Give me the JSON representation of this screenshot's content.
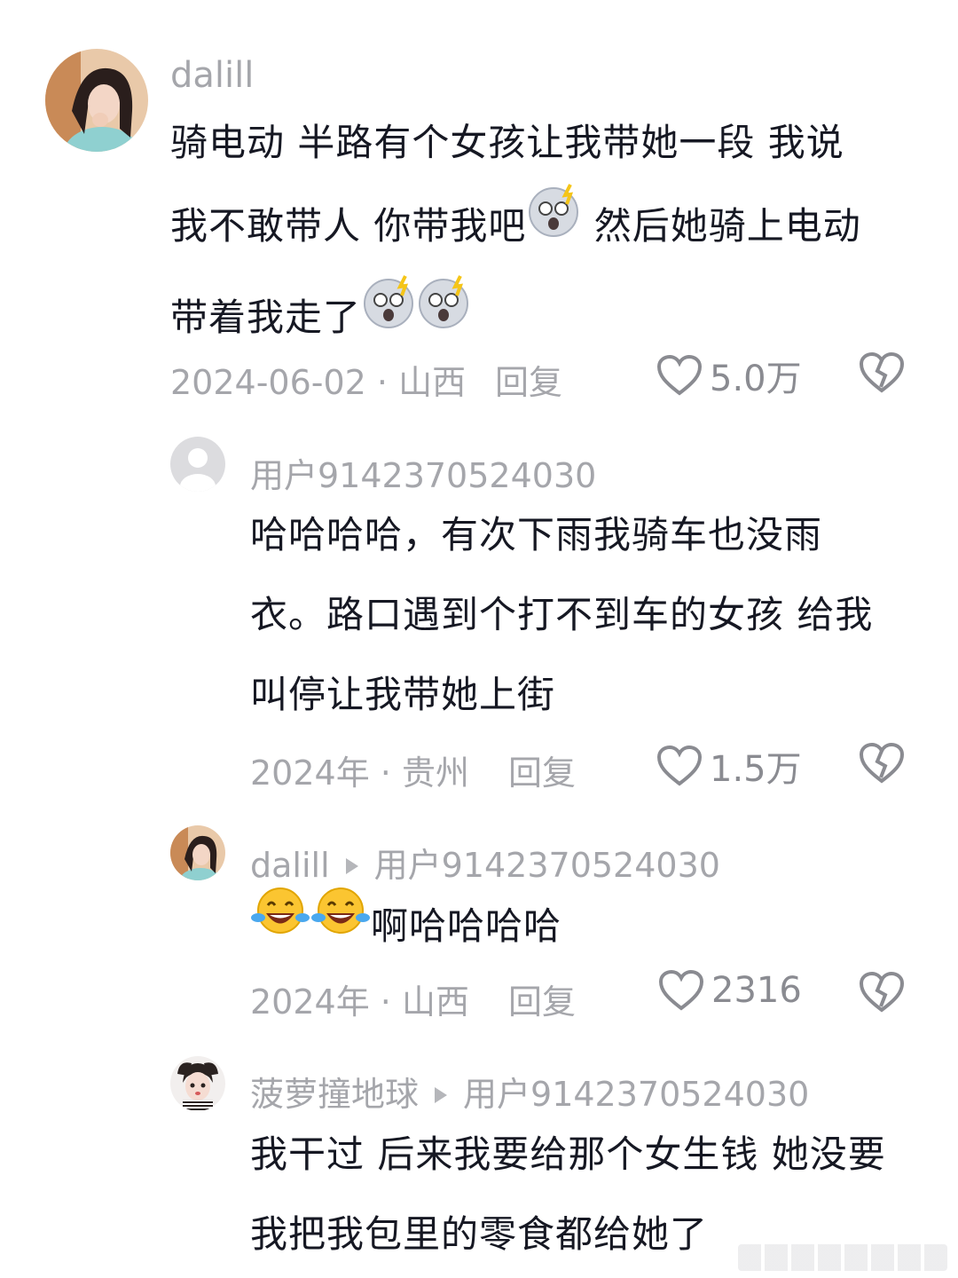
{
  "comments": [
    {
      "username": "dalill",
      "text_lines": [
        "骑电动 半路有个女孩让我带她一段  我说",
        "我不敢带人  你带我吧",
        " 然后她骑上电动",
        "带着我走了"
      ],
      "meta": "2024-06-02 · 山西",
      "reply_label": "回复",
      "likes": "5.0万"
    },
    {
      "username": "用户9142370524030",
      "text_lines": [
        "哈哈哈哈，有次下雨我骑车也没雨",
        "衣。路口遇到个打不到车的女孩 给我",
        "叫停让我带她上街"
      ],
      "meta": "2024年 · 贵州",
      "reply_label": "回复",
      "likes": "1.5万"
    },
    {
      "username": "dalill",
      "reply_to": "用户9142370524030",
      "text": "啊哈哈哈哈",
      "meta": "2024年 · 山西",
      "reply_label": "回复",
      "likes": "2316"
    },
    {
      "username": "菠萝撞地球",
      "reply_to": "用户9142370524030",
      "text_lines": [
        "我干过 后来我要给那个女生钱 她没要",
        "我把我包里的零食都给她了"
      ]
    }
  ],
  "icons": {
    "like": "heart-outline-icon",
    "dislike": "broken-heart-icon",
    "reply_indicator": "play-triangle-icon",
    "emoji_shock": "shocked-face-emoji",
    "emoji_laugh": "tears-of-joy-emoji"
  },
  "colors": {
    "text": "#161823",
    "muted": "#a5a6ab",
    "icon": "#8a8b91"
  }
}
